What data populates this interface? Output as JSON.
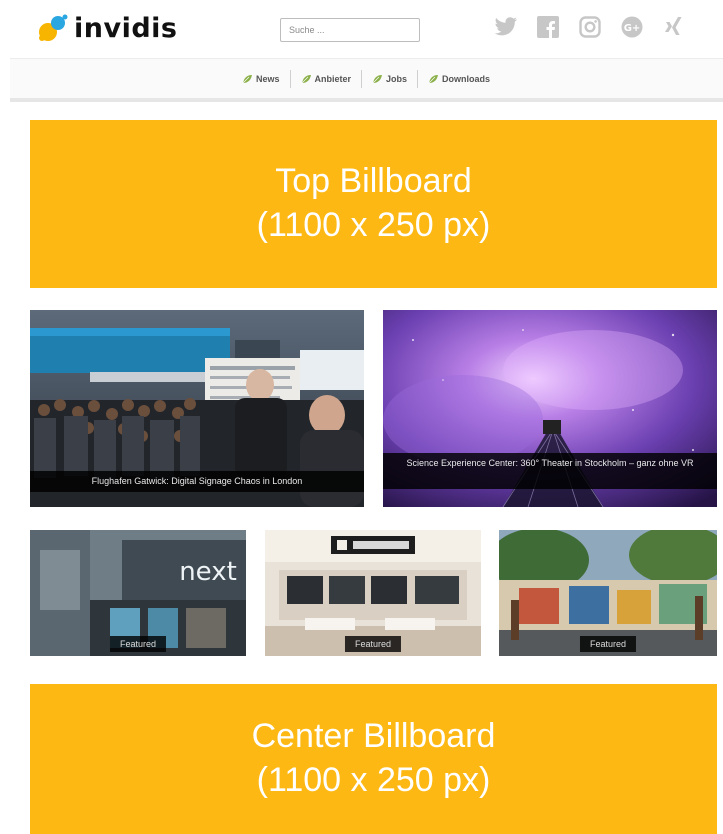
{
  "header": {
    "logo_text": "invidis",
    "search_placeholder": "Suche ...",
    "social_icons": [
      "twitter-icon",
      "facebook-icon",
      "instagram-icon",
      "google-plus-icon",
      "xing-icon"
    ]
  },
  "nav": {
    "items": [
      {
        "label": "News"
      },
      {
        "label": "Anbieter"
      },
      {
        "label": "Jobs"
      },
      {
        "label": "Downloads"
      }
    ]
  },
  "billboards": {
    "top": {
      "line1": "Top Billboard",
      "line2": "(1100 x 250 px)"
    },
    "center": {
      "line1": "Center Billboard",
      "line2": "(1100 x 250 px)"
    }
  },
  "featured_large": [
    {
      "caption": "Flughafen Gatwick: Digital Signage Chaos in London"
    },
    {
      "caption": "Science Experience Center: 360° Theater in Stockholm – ganz ohne VR"
    }
  ],
  "featured_small": [
    {
      "badge": "Featured"
    },
    {
      "badge": "Featured"
    },
    {
      "badge": "Featured"
    }
  ],
  "colors": {
    "accent": "#fdb813",
    "logo_dot_blue": "#2aa6e0",
    "logo_dot_yellow": "#f7b500",
    "icon_gray": "#c7c7c7",
    "nav_leaf": "#8bb04a"
  }
}
